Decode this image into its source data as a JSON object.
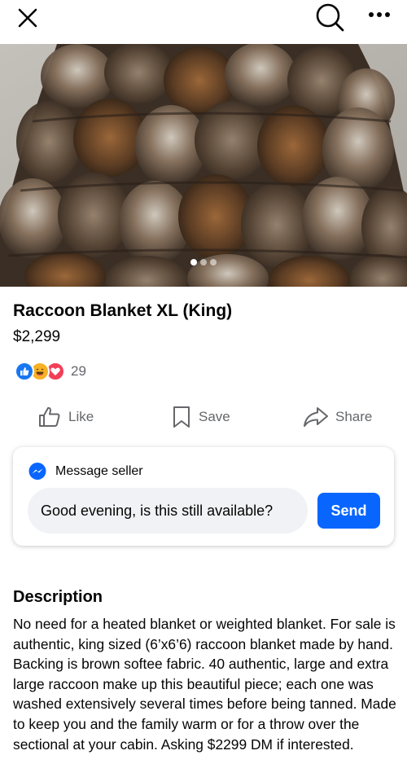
{
  "topbar": {
    "close_icon": "close-icon",
    "search_icon": "search-icon",
    "more_icon": "more-horizontal-icon"
  },
  "photo": {
    "description_icon": "product-photo",
    "carousel": {
      "count": 3,
      "active_index": 0
    }
  },
  "listing": {
    "title": "Raccoon Blanket XL (King)",
    "price": "$2,299"
  },
  "reactions": {
    "types": [
      "like",
      "haha",
      "love"
    ],
    "count": "29",
    "colors": {
      "like": "#1877f2",
      "haha": "#f7b125",
      "love": "#f33e58"
    }
  },
  "actions": {
    "like_label": "Like",
    "save_label": "Save",
    "share_label": "Share"
  },
  "message": {
    "header": "Message seller",
    "input_value": "Good evening, is this still available?",
    "send_label": "Send",
    "accent": "#0866ff"
  },
  "description": {
    "heading": "Description",
    "body": "No need for a heated blanket or weighted blanket. For sale is authentic, king sized (6’x6’6) raccoon blanket made by hand. Backing is brown softee fabric. 40 authentic, large and extra large raccoon make up this beautiful piece; each one was washed extensively several times before being tanned. Made to keep you and the family warm or for a throw over the sectional at your cabin. Asking $2299 DM if interested."
  }
}
